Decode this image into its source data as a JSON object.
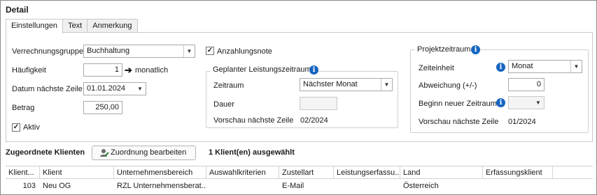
{
  "panel": {
    "title": "Detail"
  },
  "tabs": [
    {
      "label": "Einstellungen",
      "active": true
    },
    {
      "label": "Text",
      "active": false
    },
    {
      "label": "Anmerkung",
      "active": false
    }
  ],
  "settings": {
    "verrechnungsgruppe": {
      "label": "Verrechnungsgruppe",
      "value": "Buchhaltung"
    },
    "haeufigkeit": {
      "label": "Häufigkeit",
      "value": "1",
      "unit": "monatlich"
    },
    "datum": {
      "label": "Datum nächste Zeile",
      "value": "01.01.2024"
    },
    "betrag": {
      "label": "Betrag",
      "value": "250,00"
    },
    "aktiv": {
      "label": "Aktiv",
      "checked": true
    },
    "anzahlungsnote": {
      "label": "Anzahlungsnote",
      "checked": true
    }
  },
  "leistungszeitraum": {
    "title": "Geplanter Leistungszeitraum",
    "zeitraum": {
      "label": "Zeitraum",
      "value": "Nächster Monat"
    },
    "dauer": {
      "label": "Dauer",
      "value": ""
    },
    "vorschau": {
      "label": "Vorschau nächste Zeile",
      "value": "02/2024"
    }
  },
  "projektzeitraum": {
    "title": "Projektzeitraum",
    "zeiteinheit": {
      "label": "Zeiteinheit",
      "value": "Monat"
    },
    "abweichung": {
      "label": "Abweichung (+/-)",
      "value": "0"
    },
    "beginn": {
      "label": "Beginn neuer Zeitraum",
      "value": ""
    },
    "vorschau": {
      "label": "Vorschau nächste Zeile",
      "value": "01/2024"
    }
  },
  "clients": {
    "title": "Zugeordnete Klienten",
    "button_label": "Zuordnung bearbeiten",
    "selection_info": "1 Klient(en) ausgewählt",
    "columns": [
      "Klient...",
      "Klient",
      "Unternehmensbereich",
      "Auswahlkriterien",
      "Zustellart",
      "Leistungserfassu...",
      "Land",
      "Erfassungsklient"
    ],
    "rows": [
      [
        "103",
        "Neu OG",
        "RZL Unternehmensberat...",
        "",
        "E-Mail",
        "",
        "Österreich",
        ""
      ]
    ]
  },
  "colors": {
    "info_icon": "#1565c0",
    "accent_green": "#2e7d32"
  }
}
